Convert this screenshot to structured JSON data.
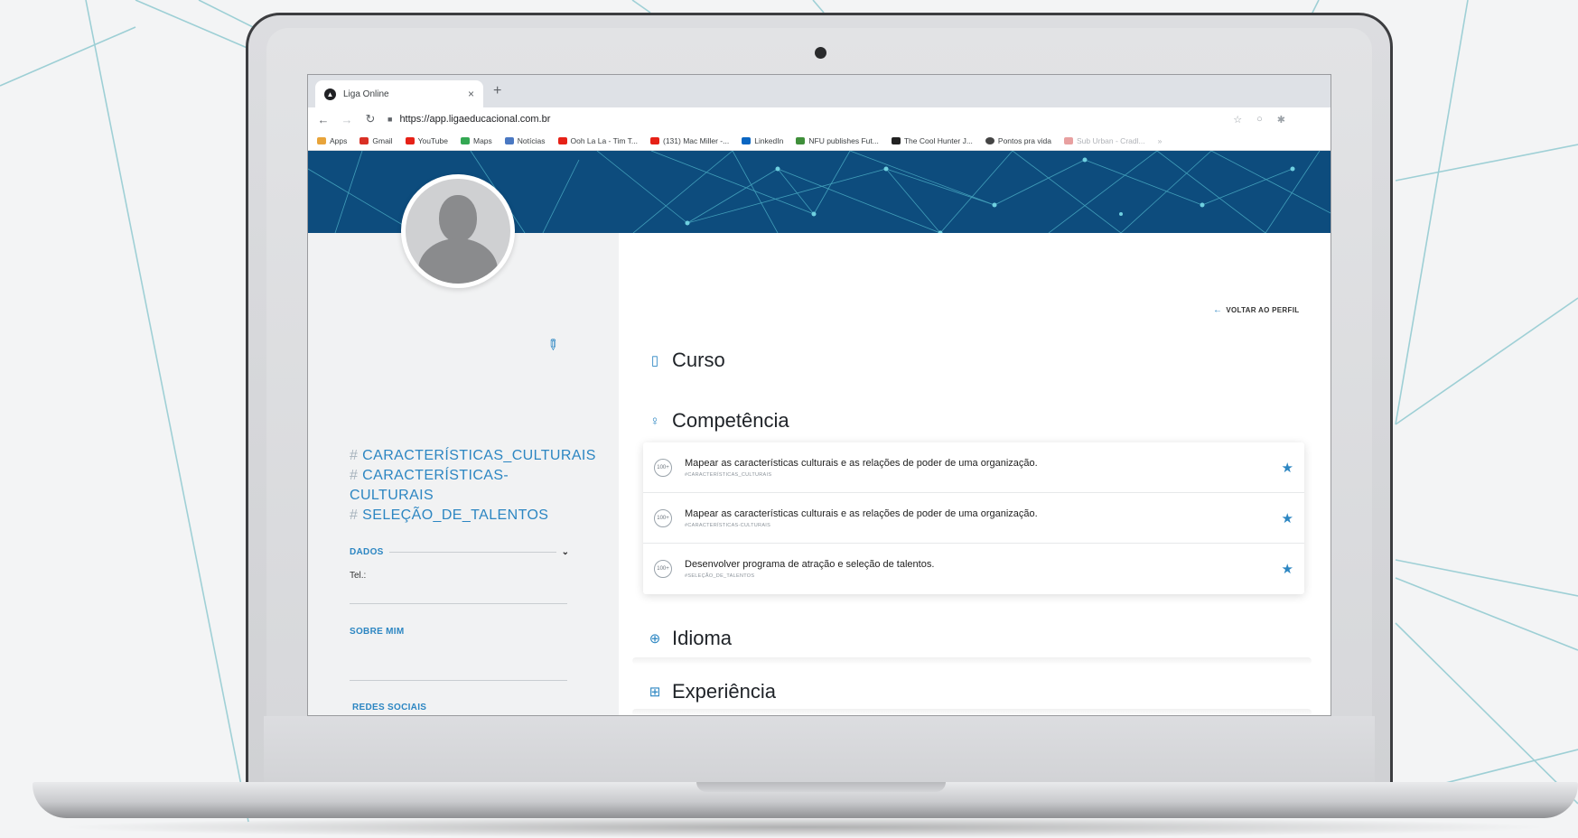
{
  "browser": {
    "tab_title": "Liga Online",
    "tab_close": "×",
    "new_tab": "+",
    "url": "https://app.ligaeducacional.com.br",
    "bookmarks": [
      {
        "label": "Apps",
        "color": "#e8a43a"
      },
      {
        "label": "Gmail",
        "color": "#d93025"
      },
      {
        "label": "YouTube",
        "color": "#e62117"
      },
      {
        "label": "Maps",
        "color": "#34a853"
      },
      {
        "label": "Notícias",
        "color": "#4a78c2"
      },
      {
        "label": "Ooh La La - Tim T...",
        "color": "#e62117"
      },
      {
        "label": "(131) Mac Miller -...",
        "color": "#e62117"
      },
      {
        "label": "LinkedIn",
        "color": "#0a66c2"
      },
      {
        "label": "NFU publishes Fut...",
        "color": "#3f8f3a"
      },
      {
        "label": "The Cool Hunter J...",
        "color": "#222222"
      },
      {
        "label": "Pontos pra vida",
        "color": "#444444"
      },
      {
        "label": "Sub Urban - Cradl...",
        "color": "#e8a0a0"
      }
    ],
    "bookmarks_more": "»"
  },
  "sidebar": {
    "tags": [
      {
        "hash": "#",
        "text": "CARACTERÍSTICAS_CULTURAIS"
      },
      {
        "hash": "#",
        "text": "CARACTERÍSTICAS-"
      },
      {
        "hash": "",
        "text": "CULTURAIS"
      },
      {
        "hash": "#",
        "text": "SELEÇÃO_DE_TALENTOS"
      }
    ],
    "dados_label": "DADOS",
    "tel_label": "Tel.:",
    "sobre_label": "SOBRE MIM",
    "redes_label": "REDES SOCIAIS"
  },
  "main": {
    "back_label": "VOLTAR AO PERFIL",
    "sections": {
      "curso": "Curso",
      "competencia": "Competência",
      "idioma": "Idioma",
      "experiencia": "Experiência"
    },
    "competencias": [
      {
        "badge": "100+",
        "title": "Mapear as características culturais e as relações de poder de uma organização.",
        "tag": "#CARACTERÍSTICAS_CULTURAIS"
      },
      {
        "badge": "100+",
        "title": "Mapear as características culturais e as relações de poder de uma organização.",
        "tag": "#CARACTERÍSTICAS-CULTURAIS"
      },
      {
        "badge": "100+",
        "title": "Desenvolver programa de atração e seleção de talentos.",
        "tag": "#SELEÇÃO_DE_TALENTOS"
      }
    ]
  },
  "colors": {
    "banner": "#0d4c7d",
    "accent": "#2c86c2",
    "sidebar_bg": "#f1f2f3"
  }
}
